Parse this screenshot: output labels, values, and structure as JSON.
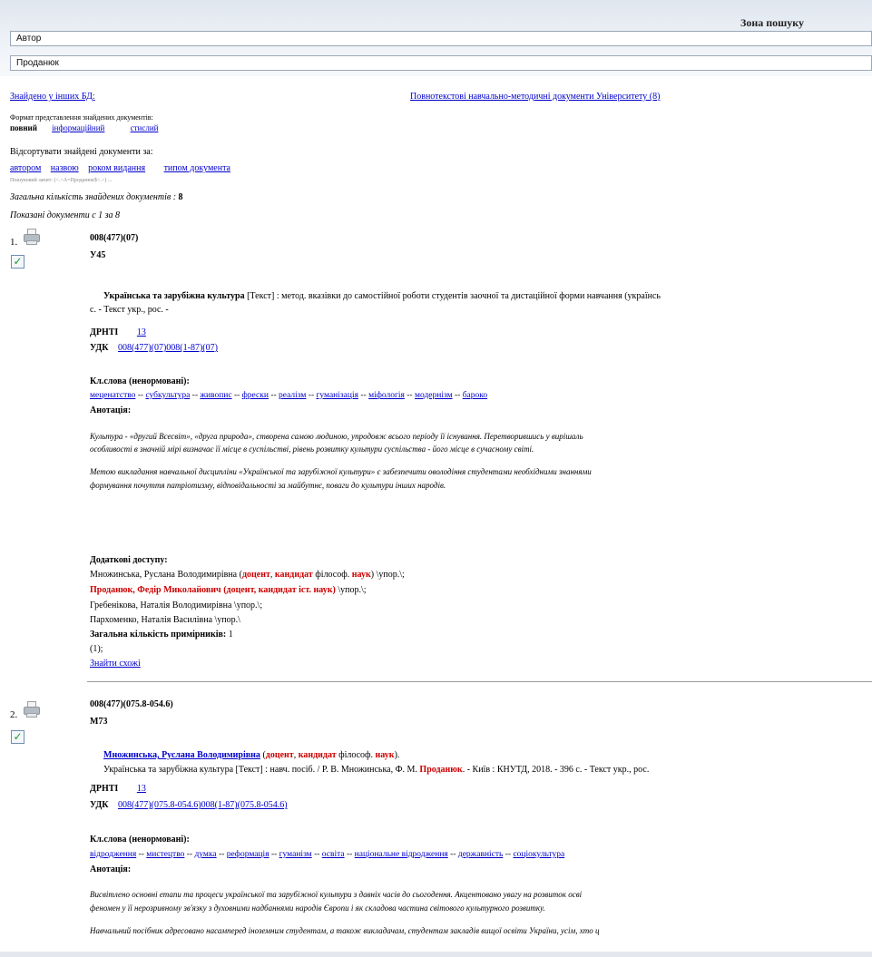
{
  "search": {
    "zone_title": "Зона пошуку",
    "field1_value": "Автор",
    "field2_value": "Проданюк"
  },
  "found_other_db": "Знайдено у інших БД:",
  "fulltext_link": "Повнотекстові навчально-методичні документи Університету (8)",
  "format": {
    "label": "Формат представлення знайдених документів:",
    "current": "повний",
    "info_link": "інформаційний",
    "short_link": "стислий"
  },
  "sort": {
    "label": "Відсортувати знайдені документи за:",
    "by_author": "автором",
    "by_title": "назвою",
    "by_year": "роком видання",
    "by_type": "типом документа"
  },
  "tiny_note": "Пошуковий запит: (<.>A=Проданюк$<.>) ...",
  "total_found_label": "Загальна кількість знайдених документів :",
  "total_found_value": "8",
  "shown_label": "Показані документи с 1 за 8",
  "records": [
    {
      "num": "1.",
      "code1": "008(477)(07)",
      "code2": "У45",
      "title_bold": "Українська та зарубіжна культура",
      "title_rest": " [Текст] : метод. вказівки до самостійної роботи студентів заочної та дистаційної форми навчання (українсь",
      "title_line2": "с. - Текст укр., рос. -",
      "grnti_label": "ДРНТІ",
      "grnti_value": "13",
      "udk_label": "УДК",
      "udk_value": "008(477)(07)008(1-87)(07)",
      "kw_label": "Кл.слова (ненормовані):",
      "keywords": [
        "меценатство",
        "субкультура",
        "живопис",
        "фрески",
        "реалізм",
        "гуманізація",
        "міфологія",
        "модернізм",
        "бароко"
      ],
      "annot_label": "Анотація:",
      "annot_p1_l1": "Культура - «другий Всесвіт», «друга природа», створена самою людиною, упродовж всього періоду її існування. Перетворившись у вирішаль",
      "annot_p1_l2": "особливості в значній мірі визначає її місце в суспільстві, рівень розвитку культури суспільства - його місце в сучасному світі.",
      "annot_p2_l1": "Метою викладання навчальної дисципліни «Української та зарубіжної культури» є забезпечити оволодіння студентами необхідними знаннями",
      "annot_p2_l2": "формування почуття патріотизму, відповідальності за майбутнє, поваги до культури інших народів.",
      "contrib_label": "Додаткові доступу:",
      "contrib1_name": "Множинська, Руслана Володимирівна",
      "contrib1_t1": "доцент",
      "contrib1_t2": "кандидат",
      "contrib1_t3": "філософ.",
      "contrib1_t4": "наук",
      "contrib1_role": "\\упор.\\;",
      "contrib2_name": "Проданюк, Федір Миколайович",
      "contrib2_t1": "доцент",
      "contrib2_t2": "кандидат",
      "contrib2_t3": "іст.",
      "contrib2_t4": "наук",
      "contrib2_role": "\\упор.\\;",
      "contrib3": "Гребенікова, Наталія Володимирівна \\упор.\\;",
      "contrib4": "Пархоменко, Наталія Василівна \\упор.\\",
      "copies_label": "Загальна кількість примірників:",
      "copies_value": "1",
      "copies_detail": "(1);",
      "find_similar": "Знайти схожі"
    },
    {
      "num": "2.",
      "code1": "008(477)(075.8-054.6)",
      "code2": "М73",
      "author_link": "Множинська, Руслана Володимирівна",
      "author_t1": "доцент",
      "author_t2": "кандидат",
      "author_t3": "філософ.",
      "author_t4": "наук",
      "title_a": "Українська та зарубіжна культура [Текст] : навч. посіб. / Р. В. Множинська, Ф. М.",
      "title_red": "Проданюк",
      "title_b": ". - Київ : КНУТД, 2018. - 396 с. - Текст укр., рос.",
      "grnti_label": "ДРНТІ",
      "grnti_value": "13",
      "udk_label": "УДК",
      "udk_value": "008(477)(075.8-054.6)008(1-87)(075.8-054.6)",
      "kw_label": "Кл.слова (ненормовані):",
      "keywords": [
        "відродження",
        "мистецтво",
        "думка",
        "реформація",
        "гуманізм",
        "освіта",
        "національне відродження",
        "державність",
        "соціокультура"
      ],
      "annot_label": "Анотація:",
      "annot_p1_l1": "Висвітлено основні етапи та процеси української та зарубіжної культури з давніх часів до сьогодення. Акцентовано увагу на розвиток осві",
      "annot_p1_l2": "феномен у її нерозривному зв'язку з духовними надбаннями народів Європи і як складова частина світового культурного розвитку.",
      "annot_p2_l1": "Навчальний посібник адресовано насамперед іноземним студентам, а також викладачам, студентам закладів вищої освіти України, усім, хто ц"
    }
  ]
}
